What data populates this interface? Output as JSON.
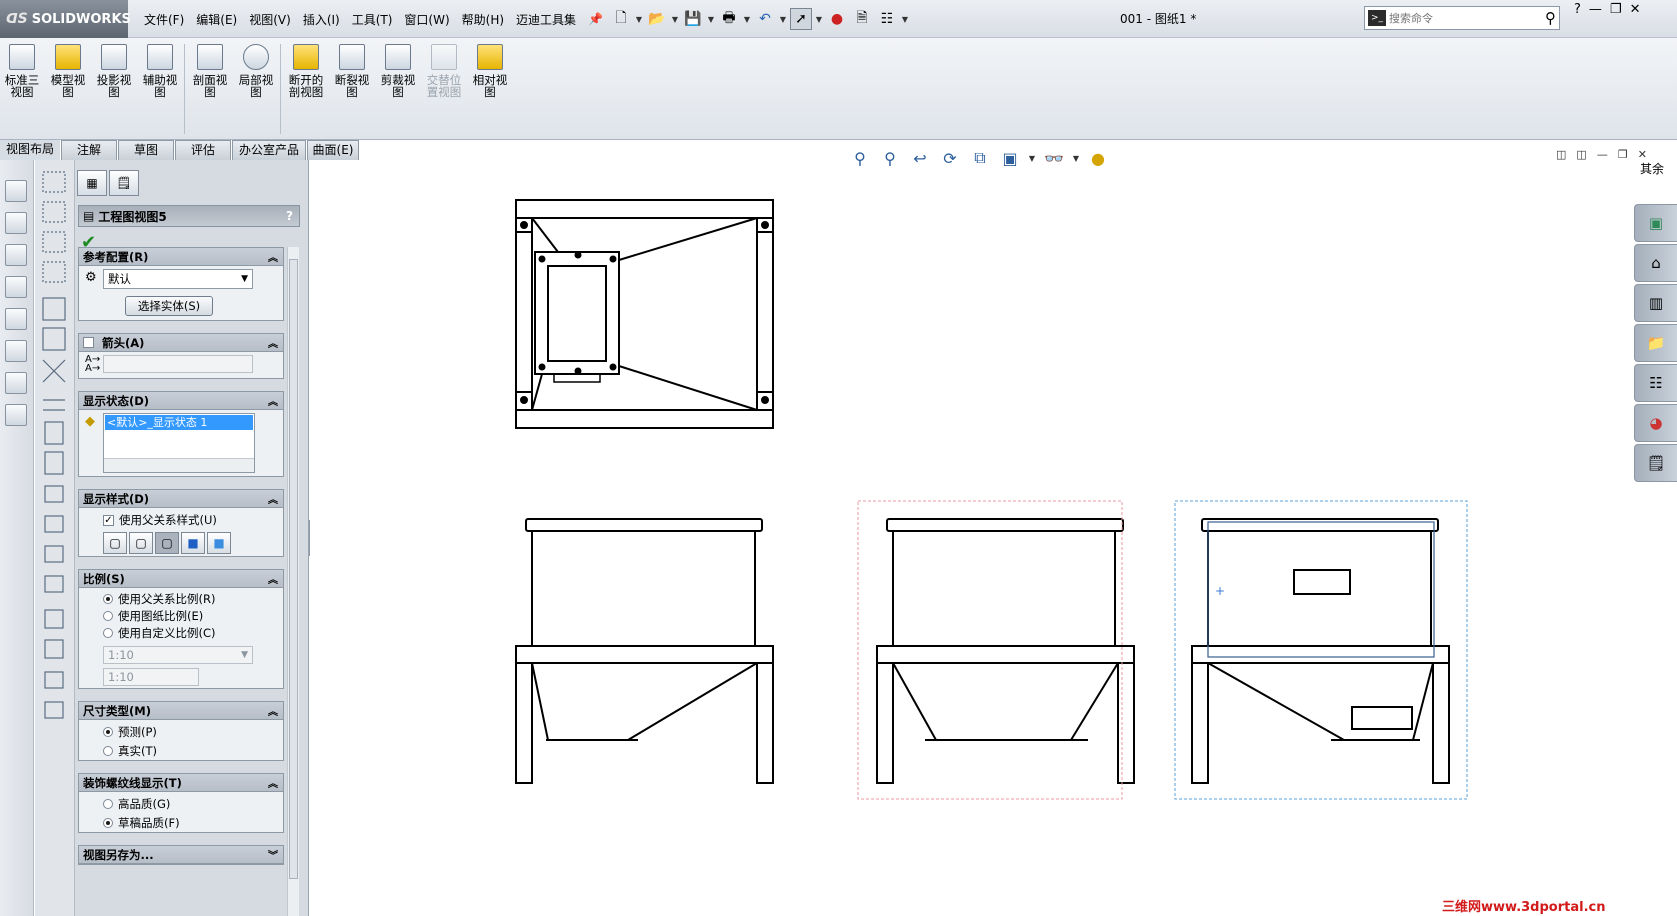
{
  "app": {
    "brand": "SOLIDWORKS",
    "doc_title": "001 - 图纸1 *"
  },
  "menu": [
    "文件(F)",
    "编辑(E)",
    "视图(V)",
    "插入(I)",
    "工具(T)",
    "窗口(W)",
    "帮助(H)",
    "迈迪工具集"
  ],
  "search": {
    "placeholder": "搜索命令"
  },
  "ribbon": [
    {
      "label": "标准三\n视图",
      "icon": "standard-3-view-icon",
      "enabled": true
    },
    {
      "label": "模型视\n图",
      "icon": "model-view-icon",
      "enabled": true
    },
    {
      "label": "投影视\n图",
      "icon": "projected-view-icon",
      "enabled": true
    },
    {
      "label": "辅助视\n图",
      "icon": "auxiliary-view-icon",
      "enabled": true
    },
    {
      "label": "剖面视\n图",
      "icon": "section-view-icon",
      "enabled": true
    },
    {
      "label": "局部视\n图",
      "icon": "detail-view-icon",
      "enabled": true
    },
    {
      "label": "断开的\n剖视图",
      "icon": "broken-out-section-icon",
      "enabled": true
    },
    {
      "label": "断裂视\n图",
      "icon": "break-view-icon",
      "enabled": true
    },
    {
      "label": "剪裁视\n图",
      "icon": "crop-view-icon",
      "enabled": true
    },
    {
      "label": "交替位\n置视图",
      "icon": "alternate-position-view-icon",
      "enabled": false
    },
    {
      "label": "相对视\n图",
      "icon": "relative-view-icon",
      "enabled": true
    }
  ],
  "tabs": [
    "视图布局",
    "注解",
    "草图",
    "评估",
    "办公室产品",
    "曲面(E)"
  ],
  "property_manager": {
    "title": "工程图视图5",
    "help": "?",
    "ref_config": {
      "header": "参考配置(R)",
      "value": "默认",
      "button": "选择实体(S)"
    },
    "arrow": {
      "header": "箭头(A)",
      "value": ""
    },
    "display_state": {
      "header": "显示状态(D)",
      "item": "<默认>_显示状态 1"
    },
    "display_style": {
      "header": "显示样式(D)",
      "checkbox": "使用父关系样式(U)",
      "checked": true
    },
    "scale": {
      "header": "比例(S)",
      "options": [
        "使用父关系比例(R)",
        "使用图纸比例(E)",
        "使用自定义比例(C)"
      ],
      "selected": 0,
      "custom_value": "1:10",
      "custom_text": "1:10"
    },
    "dim_type": {
      "header": "尺寸类型(M)",
      "options": [
        "预测(P)",
        "真实(T)"
      ],
      "selected": 0
    },
    "thread": {
      "header": "装饰螺纹线显示(T)",
      "options": [
        "高品质(G)",
        "草稿品质(F)"
      ],
      "selected": 1
    },
    "save_as": {
      "header": "视图另存为..."
    }
  },
  "graphics": {
    "other_label": "其余",
    "watermark": "三维网www.3dportal.cn"
  },
  "colors": {
    "selection_pink": "#e89aa6",
    "selection_blue": "#5ba3d9",
    "list_highlight": "#3399ff"
  }
}
